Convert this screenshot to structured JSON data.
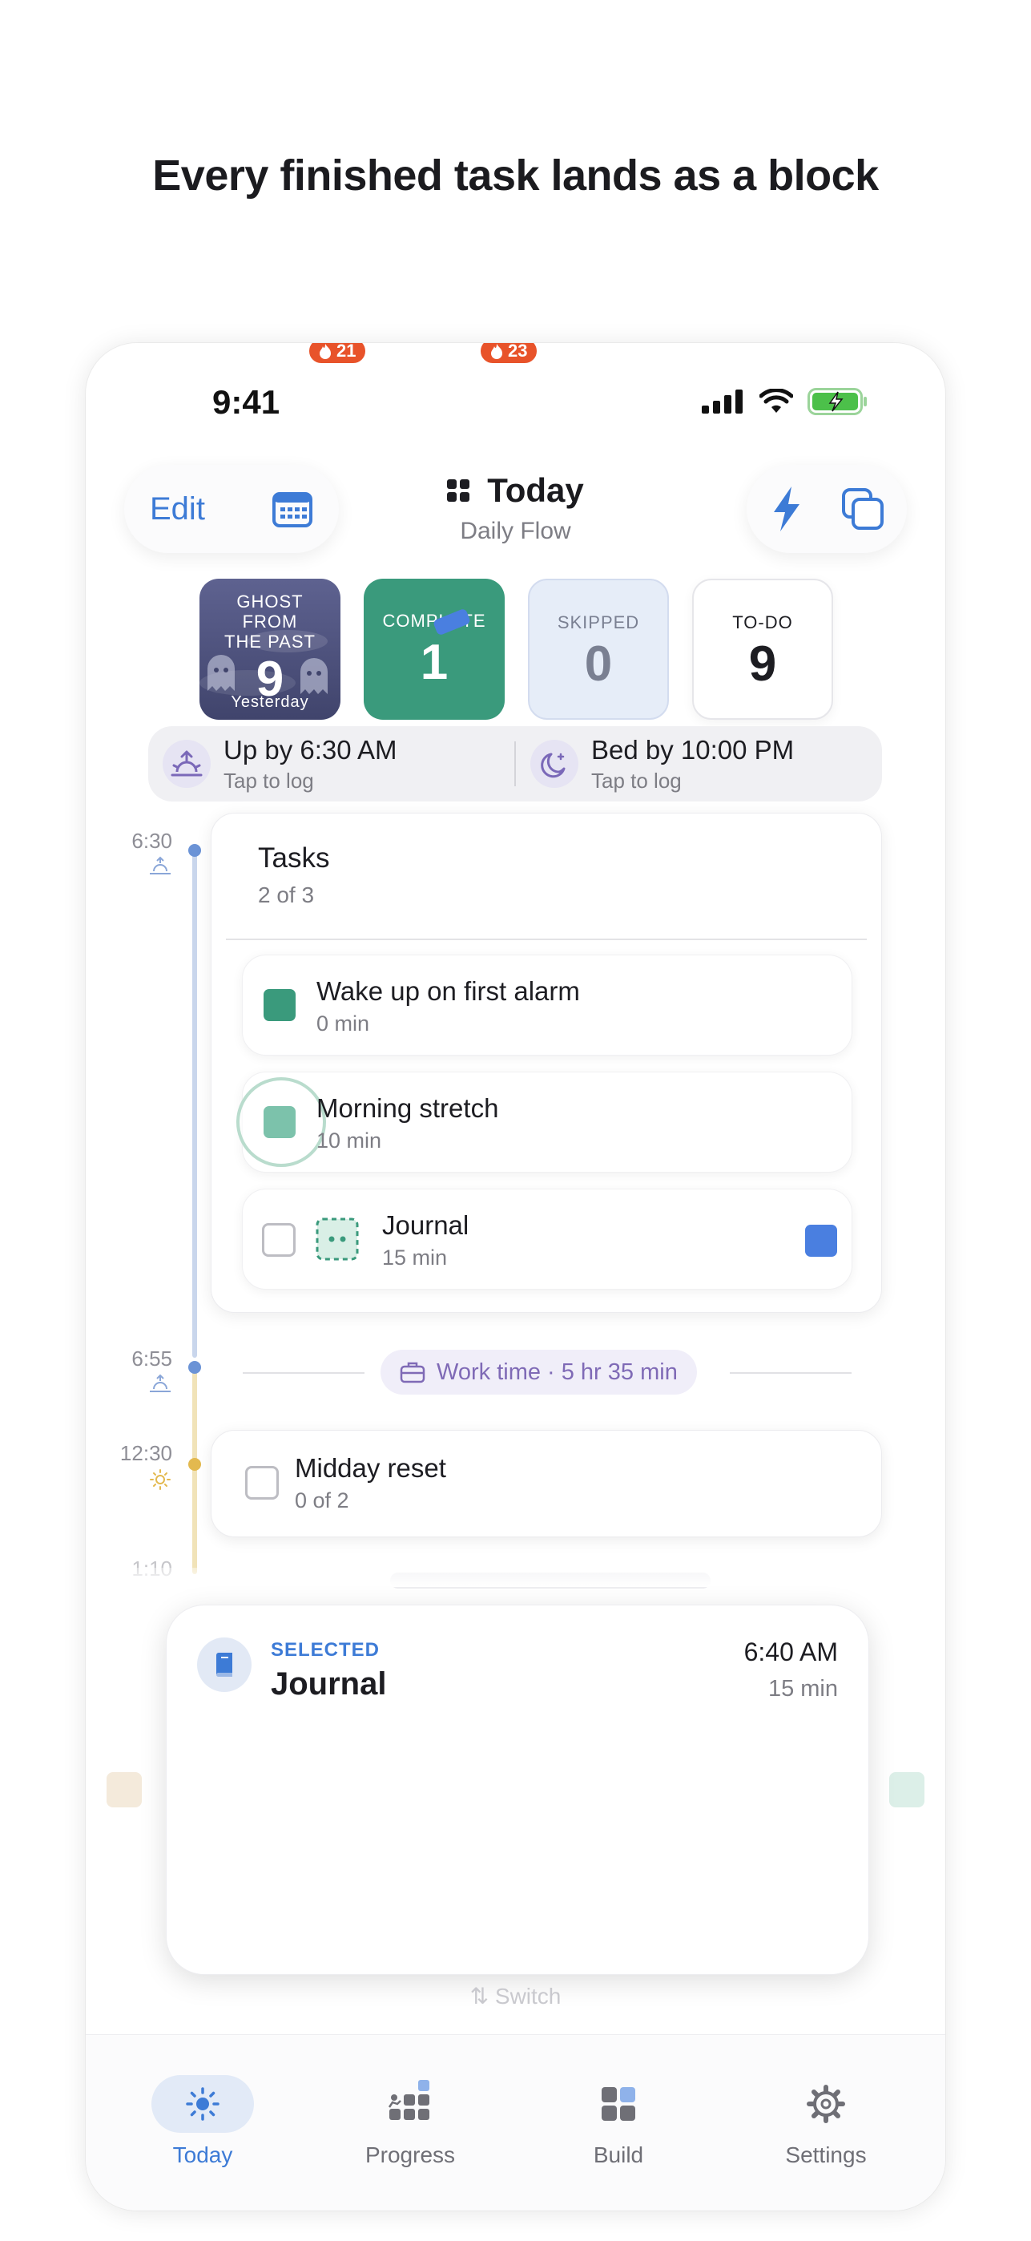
{
  "headline": "Every finished task lands as a block",
  "status_bar": {
    "time": "9:41"
  },
  "header": {
    "edit_label": "Edit",
    "title": "Today",
    "subtitle": "Daily Flow"
  },
  "stats": {
    "ghost": {
      "label_line1": "GHOST FROM",
      "label_line2": "THE PAST",
      "value": "9",
      "sub": "Yesterday",
      "streak": "21"
    },
    "complete": {
      "label": "COMPLETE",
      "value": "1",
      "streak": "23"
    },
    "skipped": {
      "label": "SKIPPED",
      "value": "0"
    },
    "todo": {
      "label": "TO-DO",
      "value": "9"
    }
  },
  "sleep": {
    "wake": {
      "main": "Up by 6:30 AM",
      "sub": "Tap to log"
    },
    "bed": {
      "main": "Bed by 10:00 PM",
      "sub": "Tap to log"
    }
  },
  "timeline": {
    "times": [
      "6:30",
      "6:55",
      "12:30",
      "1:10"
    ],
    "tasks_card": {
      "title": "Tasks",
      "progress": "2 of 3",
      "items": [
        {
          "name": "Wake up on first alarm",
          "duration": "0 min",
          "state": "done"
        },
        {
          "name": "Morning stretch",
          "duration": "10 min",
          "state": "done"
        },
        {
          "name": "Journal",
          "duration": "15 min",
          "state": "open"
        }
      ]
    },
    "work_time": "Work time · 5 hr 35 min",
    "midday": {
      "title": "Midday reset",
      "progress": "0 of 2"
    }
  },
  "selected": {
    "tag": "SELECTED",
    "name": "Journal",
    "time": "6:40 AM",
    "duration": "15 min",
    "switch_label": "Switch"
  },
  "tabs": [
    {
      "label": "Today",
      "active": true,
      "icon": "sun-icon"
    },
    {
      "label": "Progress",
      "active": false,
      "icon": "progress-blocks-icon"
    },
    {
      "label": "Build",
      "active": false,
      "icon": "build-grid-icon"
    },
    {
      "label": "Settings",
      "active": false,
      "icon": "gear-icon"
    }
  ],
  "colors": {
    "accent": "#3d7bd6",
    "complete_green": "#3a9a7c",
    "streak_orange": "#e8532a",
    "work_purple": "#7f6ab6"
  }
}
